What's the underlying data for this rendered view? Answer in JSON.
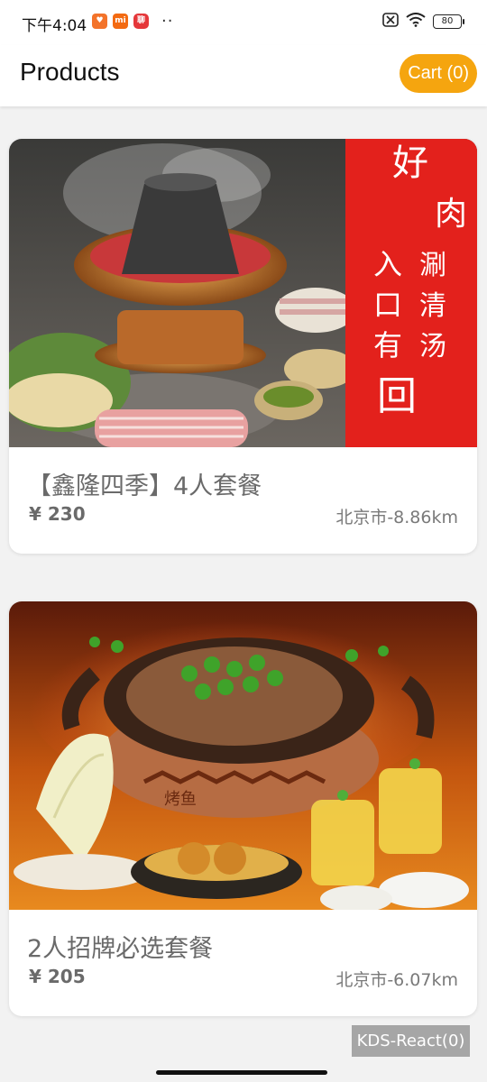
{
  "status_bar": {
    "time": "下午4:04",
    "apps": [
      {
        "icon": "app-icon",
        "glyph": "♥",
        "color": "#f3732a"
      },
      {
        "icon": "xiaomi-icon",
        "glyph": "mi",
        "color": "#f36a12"
      },
      {
        "icon": "message-app-icon",
        "glyph": "聊",
        "color": "#e5373a"
      }
    ],
    "more": "··",
    "battery": "80"
  },
  "header": {
    "title": "Products",
    "cart_label": "Cart (0)",
    "cart_color": "#f5a50f"
  },
  "products": [
    {
      "name": "【鑫隆四季】4人套餐",
      "price": "¥ 230",
      "location": "北京市-8.86km",
      "banner_text": [
        "好",
        "肉",
        "涮",
        "清",
        "汤",
        "入",
        "口",
        "有",
        "回"
      ]
    },
    {
      "name": "2人招牌必选套餐",
      "price": "¥ 205",
      "location": "北京市-6.07km",
      "pot_text": "烤鱼"
    }
  ],
  "footer": {
    "kds_label": "KDS-React(0)"
  }
}
